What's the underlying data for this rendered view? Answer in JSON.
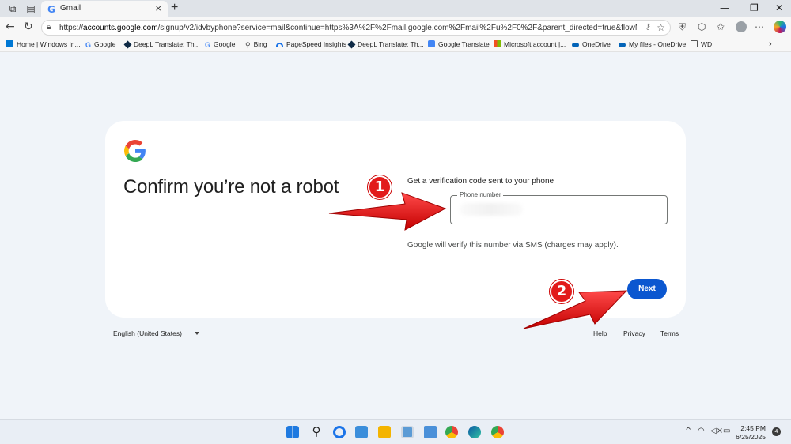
{
  "browser": {
    "tab_title": "Gmail",
    "tab_favicon": "G",
    "url_prefix": "https://",
    "url_host": "accounts.google.com",
    "url_rest": "/signup/v2/idvbyphone?service=mail&continue=https%3A%2F%2Fmail.google.com%2Fmail%2Fu%2F0%2F&parent_directed=true&flowName=GlifWe...",
    "bookmarks": [
      {
        "label": "Home | Windows In...",
        "icon": "windows-icon",
        "color": "#0078d4"
      },
      {
        "label": "Google",
        "icon": "google-icon",
        "color": "#4285f4"
      },
      {
        "label": "DeepL Translate: Th...",
        "icon": "deepl-icon",
        "color": "#0f2b46"
      },
      {
        "label": "Google",
        "icon": "google-icon",
        "color": "#4285f4"
      },
      {
        "label": "Bing",
        "icon": "bing-search-icon",
        "color": "#444"
      },
      {
        "label": "PageSpeed Insights",
        "icon": "pagespeed-icon",
        "color": "#1a73e8"
      },
      {
        "label": "DeepL Translate: Th...",
        "icon": "deepl-icon",
        "color": "#0f2b46"
      },
      {
        "label": "Google Translate",
        "icon": "google-translate-icon",
        "color": "#4285f4"
      },
      {
        "label": "Microsoft account |...",
        "icon": "microsoft-icon",
        "color": "#f25022"
      },
      {
        "label": "OneDrive",
        "icon": "onedrive-icon",
        "color": "#0364b8"
      },
      {
        "label": "My files - OneDrive",
        "icon": "onedrive-icon",
        "color": "#0364b8"
      },
      {
        "label": "WD",
        "icon": "folder-icon",
        "color": "#555"
      }
    ]
  },
  "page": {
    "heading": "Confirm you’re not a robot",
    "prompt": "Get a verification code sent to your phone",
    "phone_label": "Phone number",
    "phone_value": "",
    "sms_note": "Google will verify this number via SMS (charges may apply).",
    "next_label": "Next"
  },
  "footer": {
    "language": "English (United States)",
    "help": "Help",
    "privacy": "Privacy",
    "terms": "Terms"
  },
  "annotations": {
    "badge1": "1",
    "badge2": "2",
    "arrow_color": "#e21b1b"
  },
  "taskbar": {
    "time": "2:45 PM",
    "date": "6/25/2025",
    "notifications": "4"
  }
}
